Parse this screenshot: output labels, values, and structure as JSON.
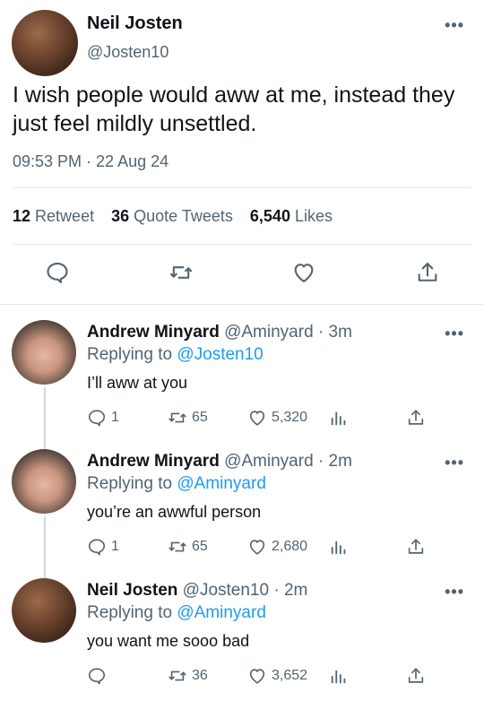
{
  "main_tweet": {
    "author_name": "Neil Josten",
    "author_handle": "@Josten10",
    "more": "•••",
    "text": "I wish people would aww at me, instead they just feel mildly unsettled.",
    "timestamp": "09:53 PM · 22 Aug 24",
    "stats": {
      "retweets_count": "12",
      "retweets_label": "Retweet",
      "quotes_count": "36",
      "quotes_label": "Quote Tweets",
      "likes_count": "6,540",
      "likes_label": "Likes"
    },
    "actions": [
      "reply-icon",
      "retweet-icon",
      "like-icon",
      "share-icon"
    ]
  },
  "replies": [
    {
      "author_name": "Andrew Minyard",
      "author_handle": "@Aminyard",
      "time": "· 3m",
      "replying_prefix": "Replying to",
      "replying_to": "@Josten10",
      "text": "I’ll aww at you",
      "reply_count": "1",
      "retweet_count": "65",
      "like_count": "5,320",
      "more": "•••"
    },
    {
      "author_name": "Andrew Minyard",
      "author_handle": "@Aminyard",
      "time": "· 2m",
      "replying_prefix": "Replying to",
      "replying_to": "@Aminyard",
      "text": "you’re an awwful person",
      "reply_count": "1",
      "retweet_count": "65",
      "like_count": "2,680",
      "more": "•••"
    },
    {
      "author_name": "Neil Josten",
      "author_handle": "@Josten10",
      "time": "· 2m",
      "replying_prefix": "Replying to",
      "replying_to": "@Aminyard",
      "text": "you want me sooo bad",
      "reply_count": "",
      "retweet_count": "36",
      "like_count": "3,652",
      "more": "•••"
    }
  ],
  "colors": {
    "text": "#0f1419",
    "secondary": "#536471",
    "link": "#1d9bf0",
    "divider": "#e6e9ec"
  }
}
